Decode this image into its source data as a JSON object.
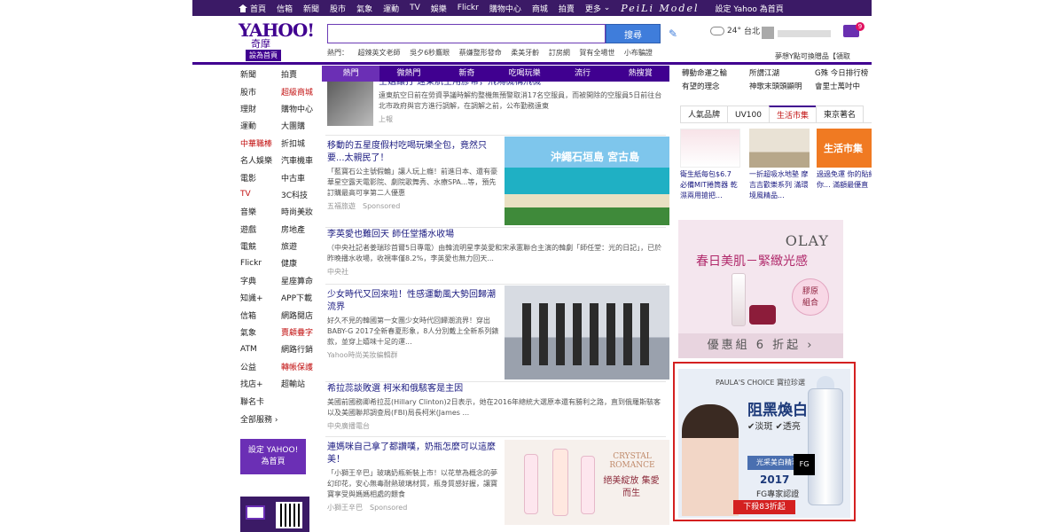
{
  "topbar": {
    "items": [
      "首頁",
      "信箱",
      "新聞",
      "股市",
      "氣象",
      "運動",
      "TV",
      "娛樂",
      "Flickr",
      "購物中心",
      "商城",
      "拍賣",
      "更多"
    ],
    "script_text": "PeiLi Model",
    "set_home": "設定 Yahoo 為首頁"
  },
  "header": {
    "logo_text": "YAHOO!",
    "logo_sub": "奇摩",
    "logo_btn": "設為首頁",
    "search_button": "搜尋",
    "hot_label": "熱門：",
    "hot_items": [
      "超辣英文老師",
      "吳夕6秒鷹眼",
      "蔡嫌整形發命",
      "柔美牙齡",
      "訂房網",
      "賀有全場世",
      "小布騙證"
    ],
    "weather_temp": "24°",
    "weather_city": "台北",
    "promo_line": "夢想Y點可換贈品【領取"
  },
  "left_nav": {
    "rows": [
      [
        "新聞",
        "拍賣"
      ],
      [
        "股市",
        "超級商城"
      ],
      [
        "理財",
        "購物中心"
      ],
      [
        "運動",
        "大團購"
      ],
      [
        "中華職棒",
        "折扣城"
      ],
      [
        "名人娛樂",
        "汽車機車"
      ],
      [
        "電影",
        "中古車"
      ],
      [
        "TV",
        "3C科技"
      ],
      [
        "音樂",
        "時尚美妝"
      ],
      [
        "遊戲",
        "房地產"
      ],
      [
        "電競",
        "旅遊"
      ],
      [
        "Flickr",
        "健康"
      ],
      [
        "字典",
        "星座算命"
      ],
      [
        "知識+",
        "APP下載"
      ],
      [
        "信箱",
        "網路閱店"
      ],
      [
        "氣象",
        "賣顧疊字"
      ],
      [
        "ATM",
        "網路行銷"
      ],
      [
        "公益",
        "轉帳保護"
      ],
      [
        "找店+",
        "超輸站"
      ],
      [
        "聯名卡",
        ""
      ]
    ],
    "all_services": "全部服務",
    "set_yahoo_1": "設定 YAHOO!",
    "set_yahoo_2": "為首頁"
  },
  "center_tabs": [
    "熱門",
    "微熱門",
    "新奇",
    "吃喝玩樂",
    "流行",
    "熱搜賞"
  ],
  "news": [
    {
      "title": "空姐讓打 遠東航空用膠帶，飛鴻機構飛機",
      "body": "遠東航空日前在勞資爭議時解約整機無預警取消17名空服員，而被開除的空服員5日前往台北市政府與官方進行調解，在調解之前，公布勤務遠東",
      "src": "上報"
    },
    {
      "title": "移動的五星度假村吃喝玩樂全包，竟然只要...太親民了！",
      "body": "「藍寶石公主號假輪」讓人玩上癮！前進日本、還有豪華星空露天電影院、劇院歌舞秀、水療SPA...等，預先訂購最高可享第二人優惠",
      "src": "五福旅遊",
      "sponsored": "Sponsored"
    },
    {
      "title": "李英愛也難回天 師任堂播水收場",
      "body": "（中央社記者姜瑞珍首爾5日專電）由韓流明星李英愛和宋承憲聯合主演的韓劇「師任堂：光的日記」，已於昨晚播水收場，收視率僅8.2%，李英愛也無力回天...",
      "src": "中央社"
    },
    {
      "title": "少女時代又回來啦！性感運動風大勢回歸潮流界",
      "body": "好久不見的韓國第一女團少女時代回歸潮流界！穿出BABY-G 2017全新春夏形象，8人分別戴上全新系列錶款，並穿上嬉味十足的運...",
      "src": "Yahoo時尚美妝編輯群"
    },
    {
      "title": "希拉蕊談敗選 柯米和俄駭客是主因",
      "body": "美國前國務卿希拉蕊(Hillary Clinton)2日表示，她在2016年總統大選原本還有勝利之路，直到俄羅斯駭客以及美國聯邦調查局(FBI)局長柯米(James ...",
      "src": "中央廣播電台"
    },
    {
      "title": "連媽咪自己拿了都讚嘆，奶瓶怎麼可以這麼美！",
      "body": "「小獅王辛巴」玻璃奶瓶新裝上市！以花草為概念的夢幻印花，安心無毒耐熱玻璃材質，瓶身質感好握，讓寶寶享受與媽媽相處的餵食",
      "src": "小獅王辛巴",
      "sponsored": "Sponsored"
    }
  ],
  "thumb_text": {
    "okinawa": "沖繩石垣島 宮古島",
    "crystal": "CRYSTAL ROMANCE",
    "crystal_cn": "絕美綻放 集愛而生"
  },
  "right_top": [
    "轉動命運之輪",
    "所謂江湖",
    "G殊 今日排行榜",
    "有望的理念",
    "神歌末頭頭顯明",
    "會里士萬吋中"
  ],
  "right_tabs": [
    "人氣品牌",
    "UV100",
    "生活市集",
    "東京著名"
  ],
  "right_tiles": [
    {
      "cap": "衛生紙每包$6.7 必備MIT捲筒器 乾濕兩用搶把..."
    },
    {
      "cap": "一折超吸水地墊 摩吉吉歡樂系列 滿環境風精品..."
    },
    {
      "cap": "過過免運 你的貼紙你... 滿額最優直"
    }
  ],
  "right_tile_badge": "生活市集",
  "olay": {
    "brand": "OLAY",
    "headline": "春日美肌－緊緻光感",
    "badge_1": "膠原",
    "badge_2": "組合",
    "footer": "優惠組 6 折起 ›"
  },
  "paula": {
    "brand": "PAULA'S CHOICE 寶拉珍選",
    "headline": "阻黑煥白",
    "sub": "✔淡斑 ✔透亮",
    "band": "光采美白精華液",
    "year": "2017",
    "cert": "FG專家認證",
    "deal": "下殺83折起",
    "fg": "FG"
  },
  "colors": {
    "purple": "#400090",
    "red_frame": "#d42020"
  }
}
